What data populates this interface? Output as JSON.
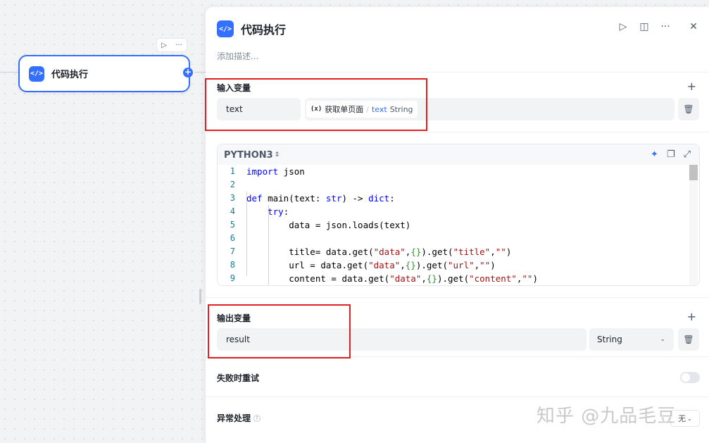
{
  "canvas": {
    "node": {
      "title": "代码执行",
      "icon": "code-icon"
    },
    "tools": {
      "run_icon": "▷",
      "more_icon": "···"
    },
    "plus_icon": "+"
  },
  "panel": {
    "title": "代码执行",
    "description_placeholder": "添加描述...",
    "actions": {
      "run": "▷",
      "split": "◫",
      "more": "···",
      "close": "✕"
    },
    "input": {
      "section_title": "输入变量",
      "add_icon": "+",
      "var_name": "text",
      "ref_icon": "(x)",
      "ref_node": "获取单页面",
      "ref_sep": "/",
      "ref_var": "text",
      "ref_type": "String",
      "delete_icon": "🗑"
    },
    "code": {
      "language": "PYTHON3",
      "switch_icon": "⇕",
      "tools": {
        "ai": "✦",
        "copy": "❐",
        "expand": "⤢"
      },
      "line_numbers": [
        "1",
        "2",
        "3",
        "4",
        "5",
        "6",
        "7",
        "8",
        "9"
      ],
      "lines": [
        "import json",
        "",
        "def main(text: str) -> dict:",
        "    try:",
        "        data = json.loads(text)",
        "",
        "        title= data.get(\"data\",{}).get(\"title\",\"\")",
        "        url = data.get(\"data\",{}).get(\"url\",\"\")",
        "        content = data.get(\"data\",{}).get(\"content\",\"\")"
      ]
    },
    "output": {
      "section_title": "输出变量",
      "add_icon": "+",
      "var_name": "result",
      "type": "String",
      "chevron": "⌄",
      "delete_icon": "🗑"
    },
    "retry": {
      "label": "失败时重试",
      "enabled": false
    },
    "exception": {
      "label": "异常处理",
      "help_icon": "?",
      "value": "无"
    }
  },
  "watermark": "知乎 @九品毛豆",
  "colors": {
    "accent": "#3370ff",
    "highlight_box": "#e02020"
  }
}
